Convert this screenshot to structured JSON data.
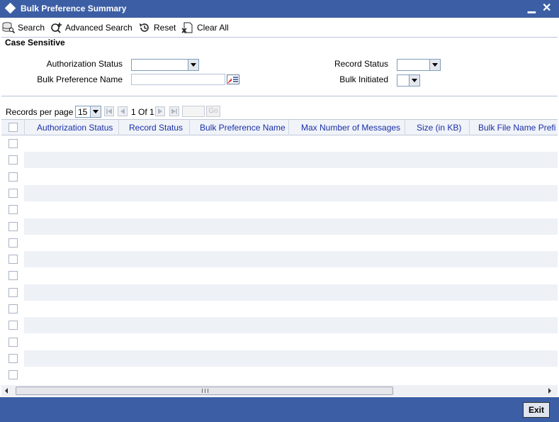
{
  "window": {
    "title": "Bulk Preference Summary",
    "minimize_glyph": "▁",
    "close_glyph": "✕"
  },
  "toolbar": {
    "search_label": "Search",
    "advanced_search_label": "Advanced Search",
    "reset_label": "Reset",
    "clear_all_label": "Clear All"
  },
  "search_panel": {
    "section_title": "Case Sensitive",
    "authorization_status_label": "Authorization Status",
    "authorization_status_value": "",
    "bulk_preference_name_label": "Bulk Preference Name",
    "bulk_preference_name_value": "",
    "record_status_label": "Record Status",
    "record_status_value": "",
    "bulk_initiated_label": "Bulk Initiated",
    "bulk_initiated_value": ""
  },
  "pager": {
    "records_per_page_label": "Records per page",
    "records_per_page_value": "15",
    "page_info": "1 Of 1",
    "goto_value": "",
    "go_label": "Go"
  },
  "grid": {
    "columns": [
      "Authorization Status",
      "Record Status",
      "Bulk Preference Name",
      "Max Number of Messages",
      "Size (in KB)",
      "Bulk File Name Prefi"
    ],
    "row_count": 15
  },
  "footer": {
    "exit_label": "Exit"
  },
  "colors": {
    "titlebar": "#3c5ea4",
    "header_text": "#1a2fa8",
    "alt_row": "#eef1f6"
  }
}
